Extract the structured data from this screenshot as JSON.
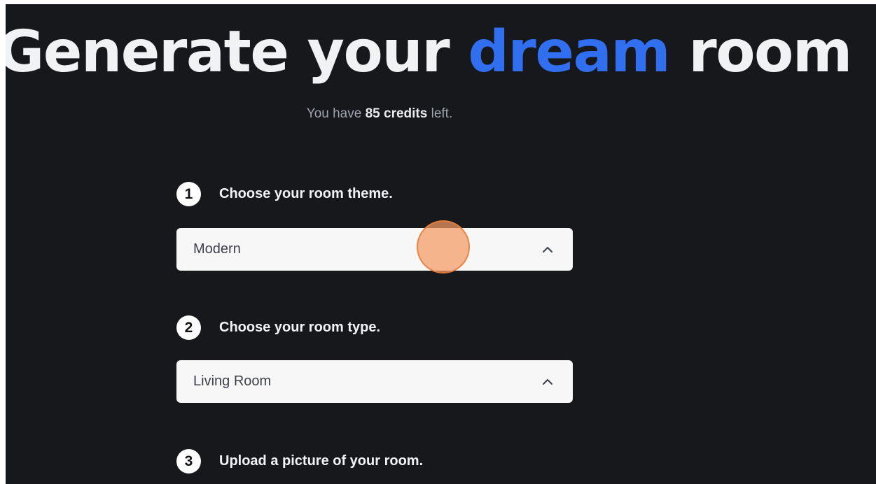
{
  "header": {
    "title_part1": "Generate your ",
    "title_accent": "dream",
    "title_part2": " room",
    "accent_color": "#2f6ff0"
  },
  "credits": {
    "prefix": "You have ",
    "count_text": "85 credits",
    "suffix": " left."
  },
  "steps": [
    {
      "number": "1",
      "label": "Choose your room theme.",
      "select": {
        "value": "Modern",
        "icon": "chevron-up-icon"
      }
    },
    {
      "number": "2",
      "label": "Choose your room type.",
      "select": {
        "value": "Living Room",
        "icon": "chevron-up-icon"
      }
    },
    {
      "number": "3",
      "label": "Upload a picture of your room."
    }
  ],
  "colors": {
    "background": "#17181c",
    "select_background": "#f7f7f8",
    "cursor_highlight": "#f49a62"
  }
}
